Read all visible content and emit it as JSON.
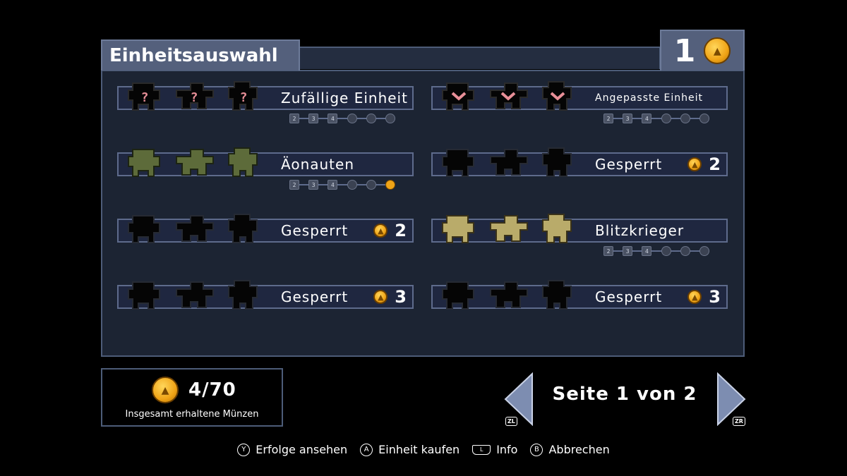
{
  "header": {
    "title": "Einheitsauswahl",
    "coin_count": "1"
  },
  "units": [
    {
      "label": "Zufällige Einheit",
      "locked": false,
      "cost": "",
      "medals": [
        "2",
        "3",
        "4",
        "",
        "",
        ""
      ],
      "gold_medal": -1,
      "sprite_style": "question"
    },
    {
      "label": "Angepasste Einheit",
      "locked": false,
      "cost": "",
      "medals": [
        "2",
        "3",
        "4",
        "",
        "",
        ""
      ],
      "gold_medal": -1,
      "sprite_style": "heart"
    },
    {
      "label": "Äonauten",
      "locked": false,
      "cost": "",
      "medals": [
        "2",
        "3",
        "4",
        "",
        "",
        ""
      ],
      "gold_medal": 5,
      "sprite_style": "green"
    },
    {
      "label": "Gesperrt",
      "locked": true,
      "cost": "2",
      "sprite_style": "shadow"
    },
    {
      "label": "Gesperrt",
      "locked": true,
      "cost": "2",
      "sprite_style": "shadow"
    },
    {
      "label": "Blitzkrieger",
      "locked": false,
      "cost": "",
      "medals": [
        "2",
        "3",
        "4",
        "",
        "",
        ""
      ],
      "gold_medal": -1,
      "sprite_style": "gold"
    },
    {
      "label": "Gesperrt",
      "locked": true,
      "cost": "3",
      "sprite_style": "shadow"
    },
    {
      "label": "Gesperrt",
      "locked": true,
      "cost": "3",
      "sprite_style": "shadow"
    }
  ],
  "coins_total": {
    "count": "4/70",
    "caption": "Insgesamt erhaltene Münzen"
  },
  "pagination": {
    "label": "Seite 1 von 2",
    "prev_button": "ZL",
    "next_button": "ZR"
  },
  "footer": [
    {
      "button": "Y",
      "label": "Erfolge ansehen",
      "shape": "circle"
    },
    {
      "button": "A",
      "label": "Einheit kaufen",
      "shape": "circle"
    },
    {
      "button": "L",
      "label": "Info",
      "shape": "shoulder"
    },
    {
      "button": "B",
      "label": "Abbrechen",
      "shape": "circle"
    }
  ],
  "colors": {
    "panel_bg": "#1c2433",
    "panel_border": "#4d5c78",
    "tab_bg": "#54607c",
    "coin": "#f0a417"
  }
}
